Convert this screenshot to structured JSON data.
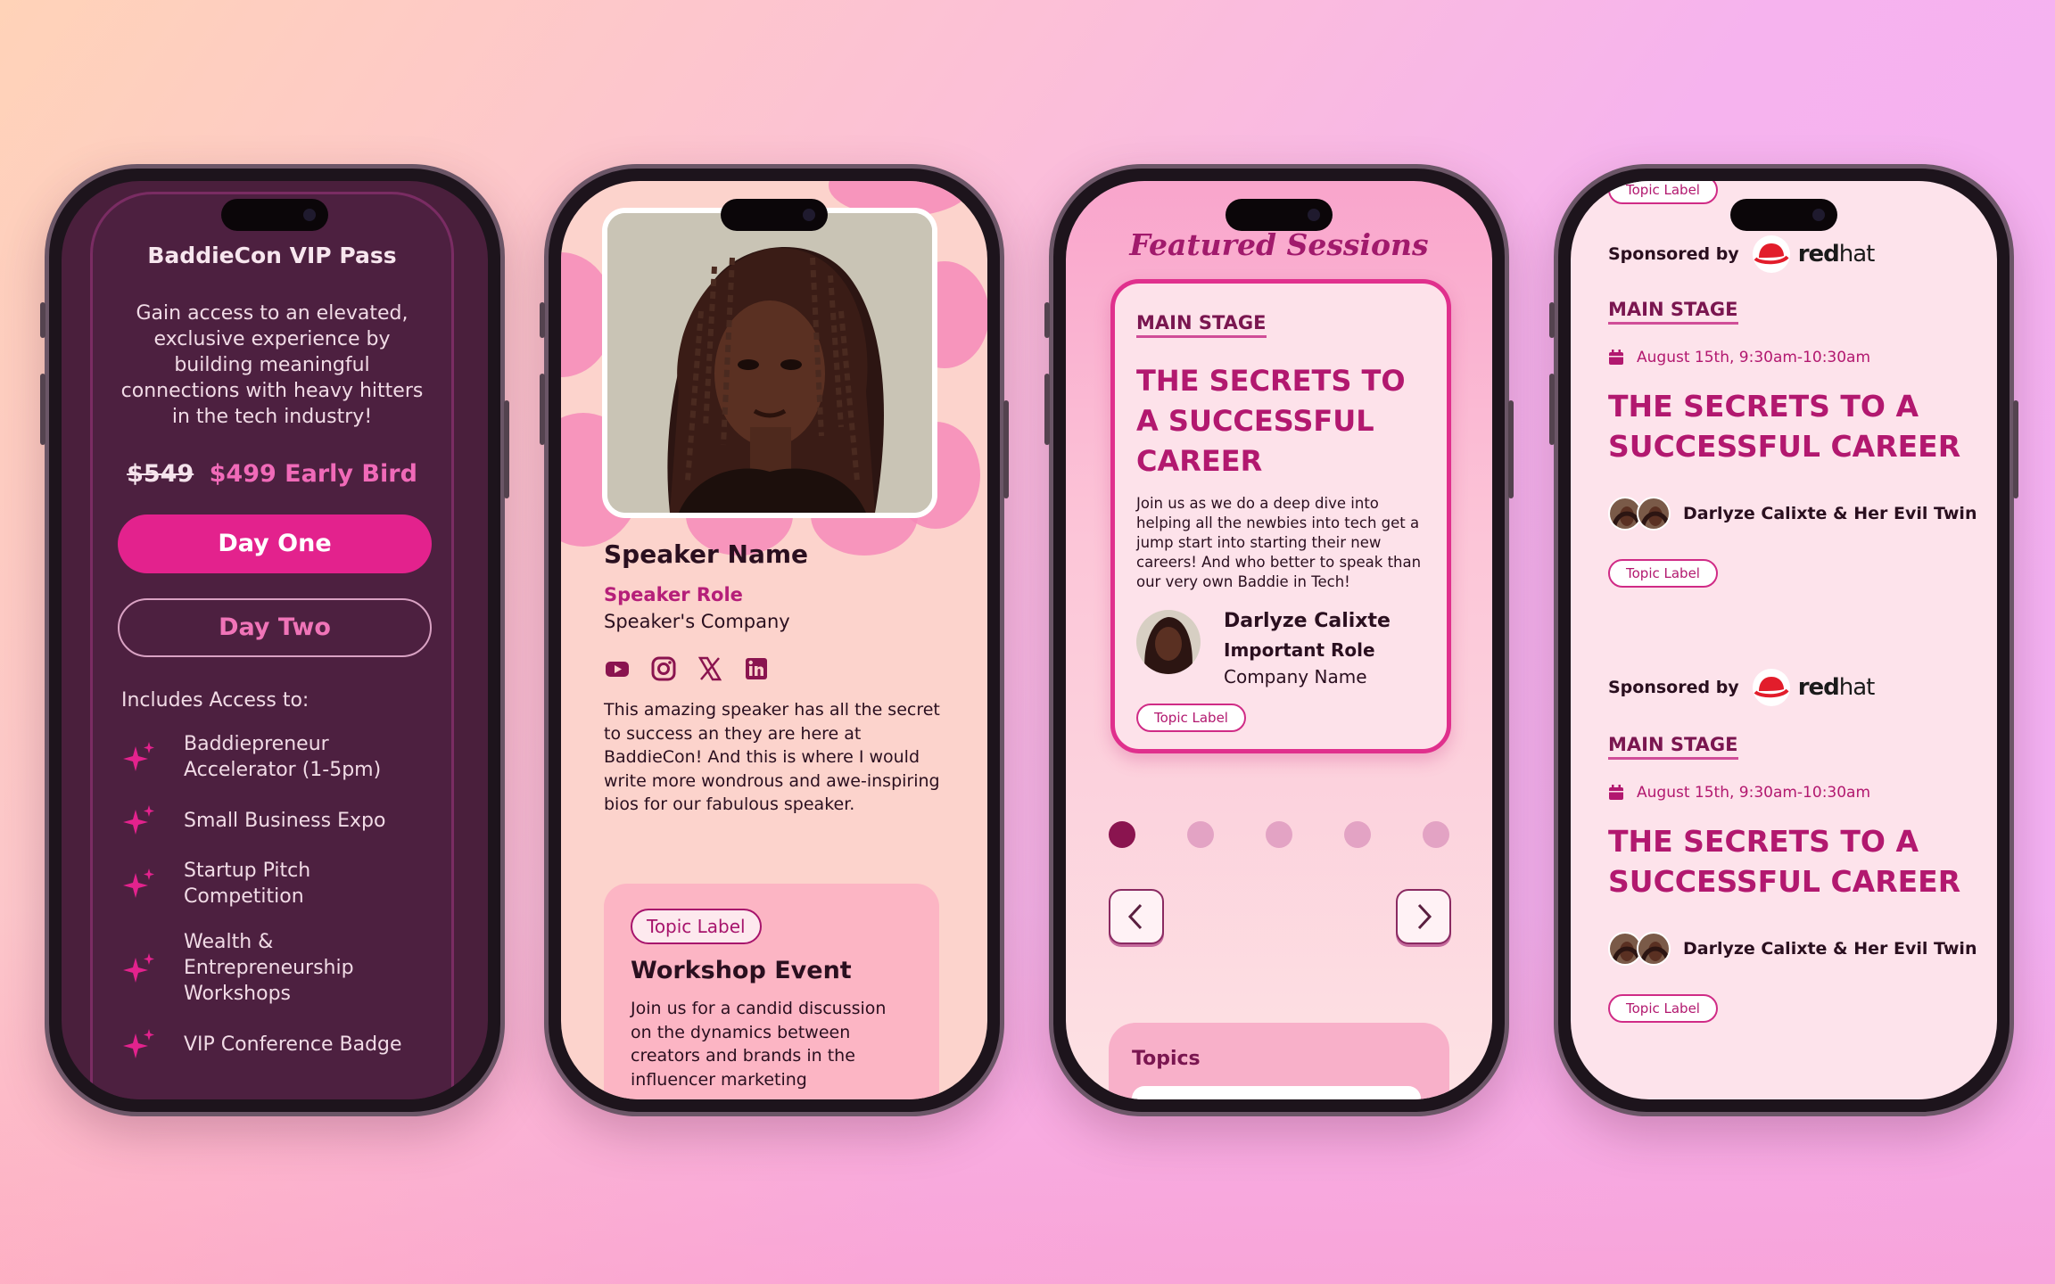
{
  "vip": {
    "title": "BaddieCon VIP Pass",
    "description": "Gain access to an elevated, exclusive experience by building meaningful connections with heavy hitters in the tech industry!",
    "old_price": "$549",
    "new_price": "$499 Early Bird",
    "day_one": "Day One",
    "day_two": "Day Two",
    "includes_label": "Includes Access to:",
    "features": [
      "Baddiepreneur Accelerator (1-5pm)",
      "Small Business Expo",
      "Startup Pitch Competition",
      "Wealth & Entrepreneurship Workshops",
      "VIP Conference Badge"
    ]
  },
  "speaker": {
    "name": "Speaker Name",
    "role": "Speaker Role",
    "company": "Speaker's Company",
    "bio": "This amazing speaker has all the secret to success an they are here at BaddieCon! And this is where I would write more wondrous and awe-inspiring bios for our fabulous speaker.",
    "socials": [
      "youtube-icon",
      "instagram-icon",
      "x-icon",
      "linkedin-icon"
    ],
    "event": {
      "topic": "Topic Label",
      "title": "Workshop Event",
      "description": "Join us for a candid discussion on the dynamics between creators and brands in the influencer marketing"
    }
  },
  "featured": {
    "heading": "Featured Sessions",
    "stage": "MAIN STAGE",
    "title": "THE SECRETS TO A SUCCESSFUL CAREER",
    "description": "Join us as we do a deep dive into helping all the newbies into tech get a jump start into starting their new careers! And who better to speak than our very own Baddie in Tech!",
    "speaker_name": "Darlyze Calixte",
    "speaker_role": "Important Role",
    "speaker_company": "Company Name",
    "topic": "Topic Label",
    "carousel_count": 5,
    "carousel_active": 1,
    "topics_label": "Topics"
  },
  "schedule": {
    "top_topic": "Topic Label",
    "sponsored_by": "Sponsored by",
    "sponsor_brand_bold": "red",
    "sponsor_brand_light": "hat",
    "items": [
      {
        "stage": "MAIN STAGE",
        "date": "August 15th, 9:30am-10:30am",
        "title": "THE SECRETS TO A SUCCESSFUL CAREER",
        "speakers": "Darlyze Calixte & Her Evil Twin",
        "topic": "Topic Label"
      },
      {
        "stage": "MAIN STAGE",
        "date": "August 15th, 9:30am-10:30am",
        "title": "THE SECRETS TO A SUCCESSFUL CAREER",
        "speakers": "Darlyze Calixte & Her Evil Twin",
        "topic": "Topic Label"
      }
    ]
  },
  "colors": {
    "primary": "#e3228d",
    "accent": "#b2186f",
    "dark_bg": "#4a1f3c"
  }
}
